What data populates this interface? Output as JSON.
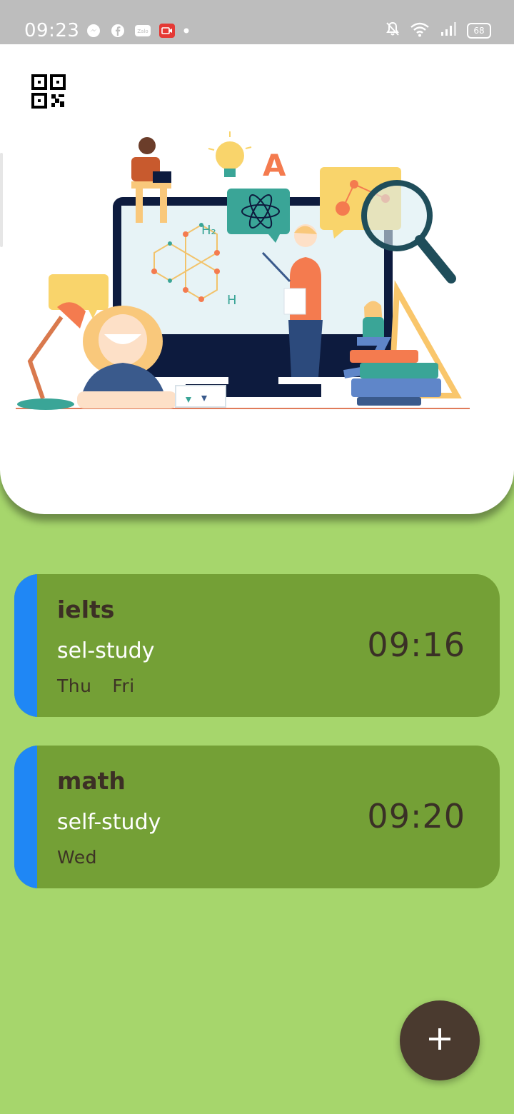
{
  "status_bar": {
    "time": "09:23",
    "notification_icons": [
      "messenger-icon",
      "facebook-icon",
      "zalo-icon",
      "video-icon",
      "dot-icon"
    ],
    "system_icons": [
      "mute-icon",
      "wifi-icon",
      "signal-icon"
    ],
    "battery": "68"
  },
  "header": {
    "qr_icon": "qr-code-icon",
    "illustration": "study-illustration"
  },
  "reminders": [
    {
      "title": "ielts",
      "subtitle": "sel-study",
      "days": "Thu  Fri",
      "time": "09:16"
    },
    {
      "title": "math",
      "subtitle": "self-study",
      "days": "Wed",
      "time": "09:20"
    }
  ],
  "fab": {
    "icon": "plus-icon"
  },
  "colors": {
    "background": "#a6d66c",
    "card": "#74a036",
    "stripe": "#1f87f5",
    "fab": "#4a3a2f",
    "header": "#ffffff"
  }
}
